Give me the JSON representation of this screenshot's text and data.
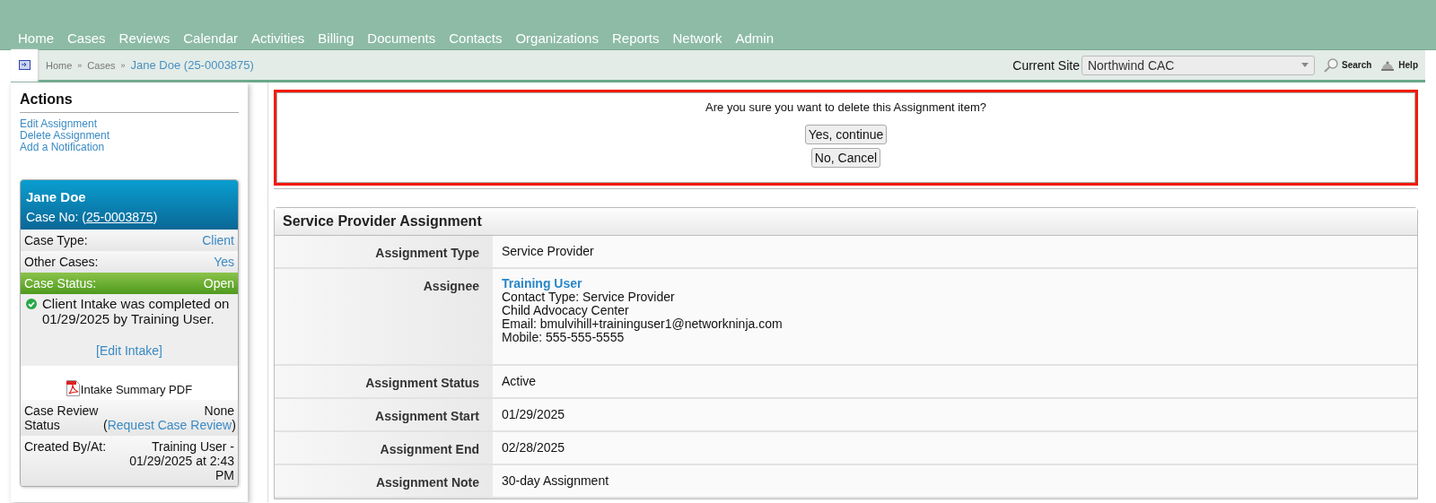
{
  "nav": {
    "items": [
      {
        "label": "Home"
      },
      {
        "label": "Cases"
      },
      {
        "label": "Reviews"
      },
      {
        "label": "Calendar"
      },
      {
        "label": "Activities"
      },
      {
        "label": "Billing"
      },
      {
        "label": "Documents"
      },
      {
        "label": "Contacts"
      },
      {
        "label": "Organizations"
      },
      {
        "label": "Reports"
      },
      {
        "label": "Network"
      },
      {
        "label": "Admin"
      }
    ]
  },
  "breadcrumb": {
    "items": [
      {
        "label": "Home",
        "current": false
      },
      {
        "label": "Cases",
        "current": false
      },
      {
        "label": "Jane Doe (25-0003875)",
        "current": true
      }
    ],
    "separator": "»"
  },
  "site": {
    "label": "Current Site",
    "value": "Northwind CAC"
  },
  "toolbar": [
    {
      "label": "Search",
      "kind": "search"
    },
    {
      "label": "Help",
      "kind": "help"
    }
  ],
  "actions": {
    "title": "Actions",
    "links": [
      "Edit Assignment",
      "Delete Assignment",
      "Add a Notification"
    ]
  },
  "case_card": {
    "name": "Jane Doe",
    "case_label": "Case No: (",
    "case_number": "25-0003875",
    "case_suffix": ")",
    "rows": [
      {
        "kind": "field",
        "label": "Case Type:",
        "value": "Client",
        "value_link": true,
        "highlighted": false
      },
      {
        "kind": "field",
        "label": "Other Cases:",
        "value": "Yes",
        "value_link": true,
        "highlighted": false
      },
      {
        "kind": "field",
        "label": "Case Status:",
        "value": "Open",
        "value_link": false,
        "highlighted": true
      },
      {
        "kind": "note",
        "text": "Client Intake was completed on 01/29/2025 by Training User."
      },
      {
        "kind": "link",
        "text": "[Edit Intake]"
      },
      {
        "kind": "pdf",
        "text": "Intake Summary PDF"
      },
      {
        "kind": "field",
        "label": "Case Review Status",
        "value": "None (",
        "link": "Request Case Review",
        "suffix": ")",
        "value_link": false,
        "highlighted": false
      },
      {
        "kind": "field",
        "label": "Created By/At:",
        "value": "Training User - 01/29/2025 at 2:43 PM",
        "value_link": false,
        "highlighted": false
      }
    ]
  },
  "confirm": {
    "message": "Are you sure you want to delete this Assignment item?",
    "buttons": [
      "Yes, continue",
      "No, Cancel"
    ]
  },
  "details": {
    "title": "Service Provider Assignment",
    "rows": [
      {
        "kind": "text",
        "label": "Assignment Type",
        "value": "Service Provider"
      },
      {
        "kind": "contact",
        "label": "Assignee",
        "link": "Training User",
        "lines": [
          "Contact Type: Service Provider",
          "Child Advocacy Center",
          "Email: bmulvihill+traininguser1@networkninja.com",
          "Mobile: 555-555-5555"
        ]
      },
      {
        "kind": "text",
        "label": "Assignment Status",
        "value": "Active"
      },
      {
        "kind": "text",
        "label": "Assignment Start",
        "value": "01/29/2025"
      },
      {
        "kind": "text",
        "label": "Assignment End",
        "value": "02/28/2025"
      },
      {
        "kind": "text",
        "label": "Assignment Note",
        "value": "30-day Assignment"
      }
    ]
  }
}
